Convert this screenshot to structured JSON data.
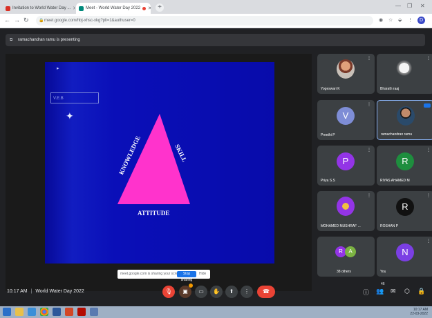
{
  "browser": {
    "tabs": [
      {
        "label": "Invitation to World Water Day ...",
        "active": false
      },
      {
        "label": "Meet - World Water Day 2022",
        "active": true
      }
    ],
    "url": "meet.google.com/hbj-xhsc-xkg?pli=1&authuser=0"
  },
  "meet": {
    "presenting_text": "ramachandran ramu is presenting",
    "slide": {
      "box_text": "V.E.B",
      "sides": {
        "left": "KNOWLEDGE",
        "right": "SKILL",
        "bottom": "ATTITUDE"
      }
    },
    "share_notice": {
      "text": "meet.google.com is sharing your screen.",
      "stop_label": "Stop sharing",
      "hide_label": "Hide"
    },
    "participants": [
      {
        "name": "Yogeswari K",
        "initial": "",
        "color": "#3c4043",
        "photo": true
      },
      {
        "name": "Bharath raaj",
        "initial": "",
        "color": "#3c4043",
        "photo": true
      },
      {
        "name": "Preethi P",
        "initial": "V",
        "color": "#7e8dd6"
      },
      {
        "name": "ramachandran ramu",
        "initial": "",
        "color": "#3c4043",
        "photo": true,
        "active": true
      },
      {
        "name": "Priya S.S",
        "initial": "P",
        "color": "#9334e6"
      },
      {
        "name": "RIYAS AHAMED M",
        "initial": "R",
        "color": "#1e8e3e"
      },
      {
        "name": "MOHAMED MUSHRAF ...",
        "initial": "",
        "color": "#9334e6",
        "photo": true
      },
      {
        "name": "ROSHAN P",
        "initial": "R",
        "color": "#111111"
      },
      {
        "name": "38 others",
        "initial": "",
        "color": "#3c4043"
      },
      {
        "name": "You",
        "initial": "N",
        "color": "#7b3fe4"
      }
    ],
    "others_avatars": [
      "R",
      "A"
    ],
    "meeting_time": "10:17 AM",
    "meeting_title": "World Water Day 2022",
    "people_count": "46"
  },
  "taskbar": {
    "time": "10:17 AM",
    "date": "22-03-2022"
  },
  "colors": {
    "accent": "#1a73e8",
    "end_call": "#ea4335",
    "slide_bg": "#0a0fb8",
    "triangle": "#ff33cc"
  }
}
